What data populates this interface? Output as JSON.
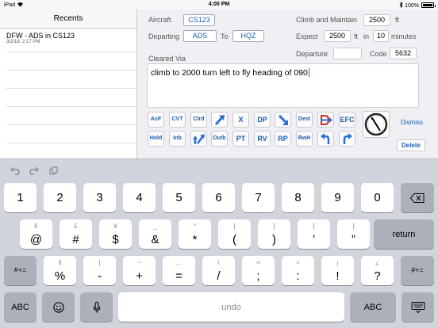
{
  "status_bar": {
    "device": "iPad",
    "wifi_icon": "wifi-icon",
    "time": "4:00 PM",
    "bluetooth_icon": "bluetooth-icon",
    "battery": "100%"
  },
  "sidebar": {
    "title": "Recents",
    "items": [
      {
        "title": "DFW - ADS in CS123",
        "subtitle": "3/2/18, 2:17 PM"
      }
    ]
  },
  "form": {
    "aircraft_label": "Aircraft",
    "aircraft_value": "CS123",
    "departing_label": "Departing",
    "departing_value": "ADS",
    "to_label": "To",
    "destination_value": "HQZ",
    "climb_label": "Climb and Maintain",
    "climb_value": "2500",
    "climb_unit": "ft",
    "expect_label": "Expect",
    "expect_value": "2500",
    "expect_unit": "ft",
    "expect_in_label": "in",
    "expect_minutes_value": "10",
    "expect_minutes_unit": "minutes",
    "departure_label": "Departure",
    "departure_value": "",
    "code_label": "Code",
    "code_value": "5632",
    "cleared_via_label": "Cleared Via",
    "cleared_via_text": "climb to 2000 turn left to  fly heading of 090",
    "dismiss_label": "Dismiss",
    "delete_label": "Delete"
  },
  "shortcuts": {
    "row1": [
      {
        "name": "afttf",
        "label": "AsF"
      },
      {
        "name": "cvt",
        "label": "CVT"
      },
      {
        "name": "clrd",
        "label": "Clrd"
      },
      {
        "name": "climb",
        "label": "",
        "icon": "arrow-up-right-icon"
      },
      {
        "name": "x",
        "label": "X"
      },
      {
        "name": "dp",
        "label": "DP"
      },
      {
        "name": "descend",
        "label": "",
        "icon": "arrow-down-right-icon"
      },
      {
        "name": "dest",
        "label": "Dest"
      },
      {
        "name": "d-arrow",
        "label": "",
        "icon": "d-arrow-icon"
      },
      {
        "name": "efc",
        "label": "EFC"
      }
    ],
    "row2": [
      {
        "name": "hold",
        "label": "Hold"
      },
      {
        "name": "inb",
        "label": "Inb"
      },
      {
        "name": "climb-turn",
        "label": "",
        "icon": "climb-turn-icon"
      },
      {
        "name": "outb",
        "label": "Outb"
      },
      {
        "name": "pt",
        "label": "PT"
      },
      {
        "name": "rv",
        "label": "RV"
      },
      {
        "name": "rp",
        "label": "RP"
      },
      {
        "name": "rwh",
        "label": "RwH"
      },
      {
        "name": "turn-left",
        "label": "",
        "icon": "turn-left-icon"
      },
      {
        "name": "turn-right",
        "label": "",
        "icon": "turn-right-icon"
      }
    ],
    "heading_dial_icon": "heading-dial-icon"
  },
  "keyboard": {
    "toolbar": {
      "undo_icon": "undo-icon",
      "redo_icon": "redo-icon",
      "paste_icon": "paste-icon"
    },
    "row1": [
      "1",
      "2",
      "3",
      "4",
      "5",
      "6",
      "7",
      "8",
      "9",
      "0"
    ],
    "row2": [
      {
        "sub": "€",
        "main": "@"
      },
      {
        "sub": "£",
        "main": "#"
      },
      {
        "sub": "¥",
        "main": "$"
      },
      {
        "sub": "_",
        "main": "&"
      },
      {
        "sub": "^",
        "main": "*"
      },
      {
        "sub": "[",
        "main": "("
      },
      {
        "sub": "]",
        "main": ")"
      },
      {
        "sub": "{",
        "main": "’"
      },
      {
        "sub": "}",
        "main": "”"
      }
    ],
    "row3": [
      {
        "sub": "§",
        "main": "%"
      },
      {
        "sub": "|",
        "main": "-"
      },
      {
        "sub": "~",
        "main": "+"
      },
      {
        "sub": "…",
        "main": "="
      },
      {
        "sub": "\\",
        "main": "/"
      },
      {
        "sub": "<",
        "main": ";"
      },
      {
        "sub": ">",
        "main": ":"
      },
      {
        "sub": "¡",
        "main": "!"
      },
      {
        "sub": "¿",
        "main": "?"
      }
    ],
    "backspace_icon": "backspace-icon",
    "return_label": "return",
    "shift_left_label": "#+=",
    "shift_right_label": "#+=",
    "abc_left_label": "ABC",
    "emoji_icon": "emoji-icon",
    "mic_icon": "microphone-icon",
    "undo_label": "undo",
    "abc_right_label": "ABC",
    "hide_keyboard_icon": "keyboard-hide-icon"
  }
}
